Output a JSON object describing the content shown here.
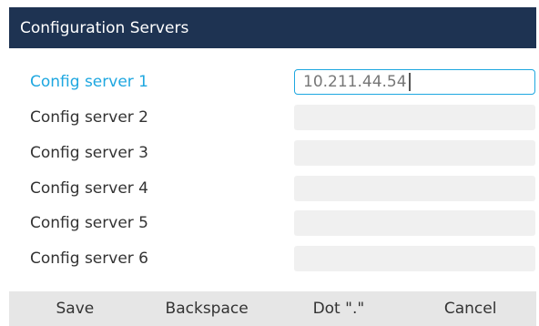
{
  "header": {
    "title": "Configuration Servers"
  },
  "servers": [
    {
      "label": "Config server 1",
      "value": "10.211.44.54"
    },
    {
      "label": "Config server 2",
      "value": ""
    },
    {
      "label": "Config server 3",
      "value": ""
    },
    {
      "label": "Config server 4",
      "value": ""
    },
    {
      "label": "Config server 5",
      "value": ""
    },
    {
      "label": "Config server 6",
      "value": ""
    }
  ],
  "softkeys": {
    "save": "Save",
    "backspace": "Backspace",
    "dot": "Dot \".\"",
    "cancel": "Cancel"
  },
  "colors": {
    "header_bg": "#1e3352",
    "accent": "#1ea7e0",
    "field_bg": "#f0f0f0",
    "softkey_bg": "#e6e6e6"
  }
}
